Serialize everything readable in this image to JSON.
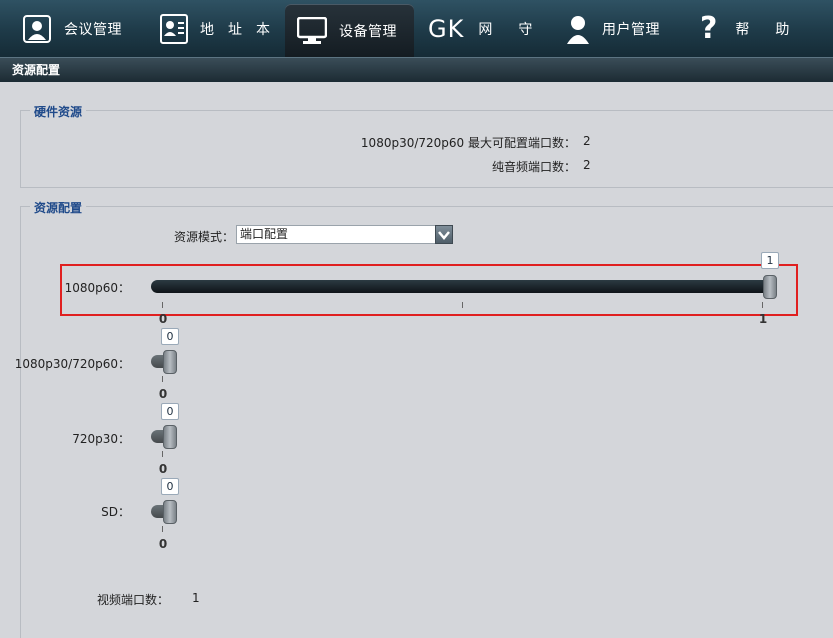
{
  "nav": {
    "items": [
      {
        "label": "会议管理",
        "icon": "meeting-icon"
      },
      {
        "label": "地址本",
        "icon": "addressbook-icon"
      },
      {
        "label": "设备管理",
        "icon": "monitor-icon",
        "active": true
      },
      {
        "label": "网守",
        "icon": "gk-icon",
        "icon_text": "GK"
      },
      {
        "label": "用户管理",
        "icon": "user-icon"
      },
      {
        "label": "帮助",
        "icon": "help-icon"
      }
    ]
  },
  "page_title": "资源配置",
  "hardware": {
    "legend": "硬件资源",
    "rows": [
      {
        "label": "1080p30/720p60 最大可配置端口数：",
        "value": "2"
      },
      {
        "label": "纯音频端口数：",
        "value": "2"
      }
    ]
  },
  "resource": {
    "legend": "资源配置",
    "mode_label": "资源模式：",
    "mode_value": "端口配置",
    "sliders": [
      {
        "label": "1080p60：",
        "value": "1",
        "min": "0",
        "max": "1",
        "fraction": 1.0
      },
      {
        "label": "1080p30/720p60：",
        "value": "0",
        "min": "0",
        "fraction": 0.0
      },
      {
        "label": "720p30：",
        "value": "0",
        "min": "0",
        "fraction": 0.0
      },
      {
        "label": "SD：",
        "value": "0",
        "min": "0",
        "fraction": 0.0
      }
    ],
    "video_ports_label": "视频端口数：",
    "video_ports_value": "1"
  },
  "colors": {
    "nav_bg": "#1e3a48",
    "accent_legend": "#1f4a8a",
    "highlight": "#e02020"
  }
}
